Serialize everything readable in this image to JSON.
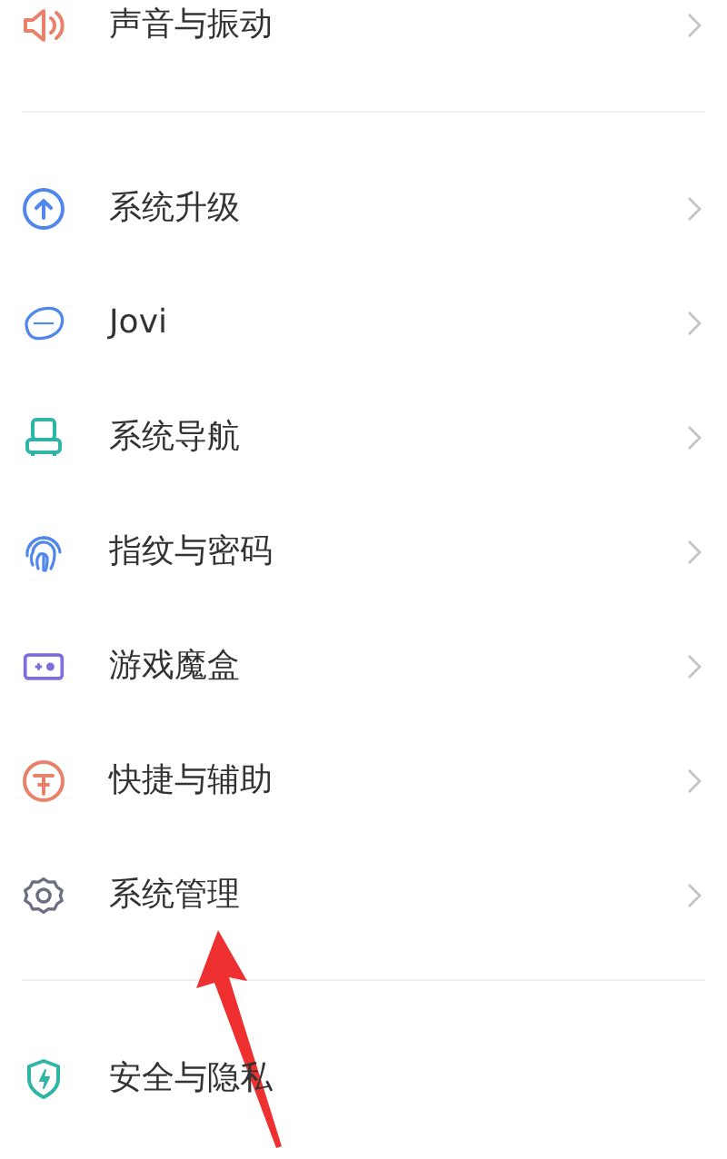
{
  "groups": [
    {
      "items": [
        {
          "label": "声音与振动",
          "chevron": true
        }
      ]
    },
    {
      "items": [
        {
          "label": "系统升级",
          "chevron": true
        },
        {
          "label": "Jovi",
          "chevron": true
        },
        {
          "label": "系统导航",
          "chevron": true
        },
        {
          "label": "指纹与密码",
          "chevron": true
        },
        {
          "label": "游戏魔盒",
          "chevron": true
        },
        {
          "label": "快捷与辅助",
          "chevron": true
        },
        {
          "label": "系统管理",
          "chevron": true
        }
      ]
    },
    {
      "items": [
        {
          "label": "安全与隐私",
          "chevron": false
        }
      ]
    }
  ]
}
